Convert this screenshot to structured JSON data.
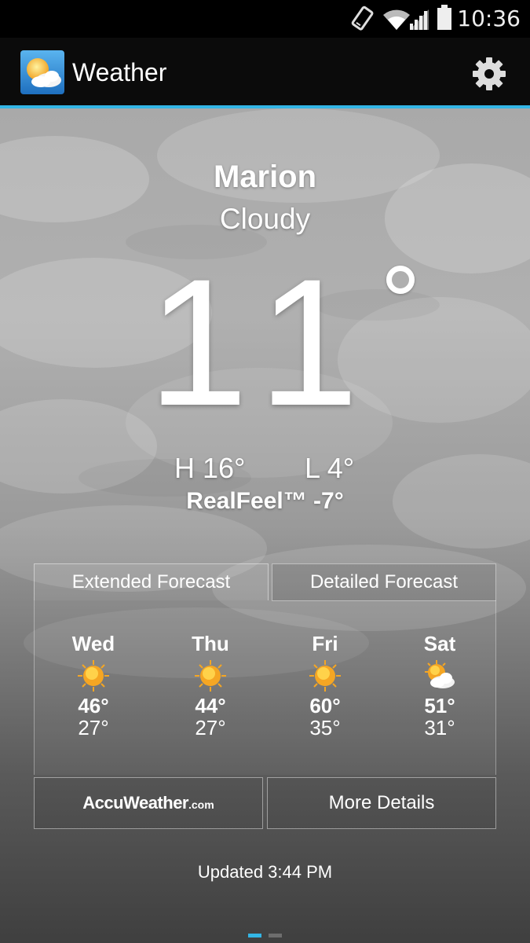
{
  "status_bar": {
    "time": "10:36",
    "icons": [
      "rotation-icon",
      "wifi-icon",
      "signal-icon",
      "battery-icon"
    ]
  },
  "action_bar": {
    "title": "Weather",
    "app_icon": "weather-sun-cloud-icon",
    "settings_icon": "gear-icon"
  },
  "current": {
    "city": "Marion",
    "condition": "Cloudy",
    "temperature": "11",
    "high": "H 16°",
    "low": "L 4°",
    "realfeel": "RealFeel™ -7°"
  },
  "tabs": {
    "extended": "Extended Forecast",
    "detailed": "Detailed Forecast"
  },
  "forecast": [
    {
      "day": "Wed",
      "icon": "sun-icon",
      "high": "46°",
      "low": "27°"
    },
    {
      "day": "Thu",
      "icon": "sun-icon",
      "high": "44°",
      "low": "27°"
    },
    {
      "day": "Fri",
      "icon": "sun-icon",
      "high": "60°",
      "low": "35°"
    },
    {
      "day": "Sat",
      "icon": "partly-cloudy-icon",
      "high": "51°",
      "low": "31°"
    }
  ],
  "buttons": {
    "accuweather_brand": "AccuWeather",
    "accuweather_suffix": ".com",
    "more_details": "More Details"
  },
  "updated": "Updated 3:44 PM",
  "colors": {
    "accent": "#33b5e5",
    "sun": "#f5a623"
  },
  "page_indicator": {
    "current": 1,
    "total": 2
  }
}
